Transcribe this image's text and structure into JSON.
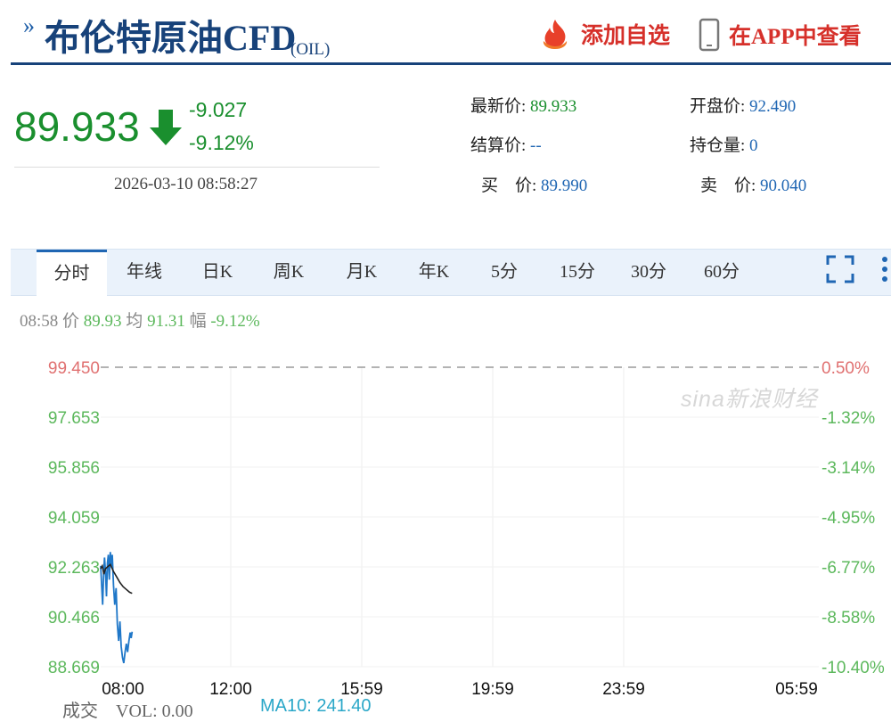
{
  "header": {
    "arrow_glyph": "»",
    "title": "布伦特原油CFD",
    "code": "(OIL)",
    "fav_label": "添加自选",
    "app_label": "在APP中查看",
    "fav_icon": "red-flame-icon",
    "app_icon": "mobile-phone-icon"
  },
  "quote": {
    "price": "89.933",
    "change": "-9.027",
    "change_pct": "-9.12%",
    "timestamp": "2026-03-10 08:58:27",
    "arrow_icon": "green-down-arrow-icon",
    "down_color": "#1a8f2e"
  },
  "details": {
    "latest_label": "最新价:",
    "latest_value": "89.933",
    "open_label": "开盘价:",
    "open_value": "92.490",
    "settle_label": "结算价:",
    "settle_value": "--",
    "oi_label": "持仓量:",
    "oi_value": "0",
    "bid_label": "买　价:",
    "bid_value": "89.990",
    "ask_label": "卖　价:",
    "ask_value": "90.040"
  },
  "tabs": [
    "分时",
    "年线",
    "日K",
    "周K",
    "月K",
    "年K",
    "5分",
    "15分",
    "30分",
    "60分"
  ],
  "active_tab": 0,
  "toolbar_icons": [
    "fullscreen-icon",
    "more-vertical-dots-icon"
  ],
  "info": {
    "time": "08:58",
    "price_label": "价",
    "price": "89.93",
    "avg_label": "均",
    "avg": "91.31",
    "amp_label": "幅",
    "amp": "-9.12%"
  },
  "watermark": "sina新浪财经",
  "volume": {
    "vol_text": "成交　VOL: 0.00",
    "ma_text": "MA10: 241.40"
  },
  "chart_data": {
    "type": "line",
    "title": "",
    "y_ticks": [
      "99.450",
      "97.653",
      "95.856",
      "94.059",
      "92.263",
      "90.466",
      "88.669"
    ],
    "y_tick_values": [
      99.45,
      97.653,
      95.856,
      94.059,
      92.263,
      90.466,
      88.669
    ],
    "y_right_ticks": [
      "0.50%",
      "-1.32%",
      "-3.14%",
      "-4.95%",
      "-6.77%",
      "-8.58%",
      "-10.40%"
    ],
    "ylim": [
      88.669,
      99.45
    ],
    "x_ticks": [
      "08:00",
      "12:00",
      "15:59",
      "19:59",
      "23:59",
      "05:59"
    ],
    "reference_line": 99.45,
    "colors": {
      "price": "#1f77c8",
      "average": "#222222",
      "up_axis": "#e07070",
      "down_axis": "#5cb85c",
      "reference": "#9a9a9a"
    },
    "series": [
      {
        "key": "price",
        "points": [
          [
            0,
            92.3
          ],
          [
            0.03,
            91.6
          ],
          [
            0.06,
            90.9
          ],
          [
            0.09,
            91.9
          ],
          [
            0.12,
            92.6
          ],
          [
            0.15,
            92.1
          ],
          [
            0.18,
            91.2
          ],
          [
            0.21,
            92.4
          ],
          [
            0.24,
            92.7
          ],
          [
            0.27,
            91.8
          ],
          [
            0.3,
            92.8
          ],
          [
            0.33,
            92.3
          ],
          [
            0.36,
            92.7
          ],
          [
            0.4,
            91.6
          ],
          [
            0.44,
            90.9
          ],
          [
            0.48,
            91.5
          ],
          [
            0.52,
            90.2
          ],
          [
            0.56,
            89.6
          ],
          [
            0.6,
            90.3
          ],
          [
            0.64,
            89.4
          ],
          [
            0.68,
            89.0
          ],
          [
            0.72,
            88.8
          ],
          [
            0.76,
            89.2
          ],
          [
            0.8,
            89.5
          ],
          [
            0.84,
            89.2
          ],
          [
            0.88,
            89.6
          ],
          [
            0.92,
            89.9
          ],
          [
            0.95,
            89.7
          ],
          [
            0.98,
            89.93
          ]
        ]
      },
      {
        "key": "average",
        "points": [
          [
            0,
            92.2
          ],
          [
            0.05,
            92.3
          ],
          [
            0.1,
            92.0
          ],
          [
            0.15,
            92.2
          ],
          [
            0.2,
            92.25
          ],
          [
            0.3,
            92.35
          ],
          [
            0.4,
            92.1
          ],
          [
            0.5,
            91.9
          ],
          [
            0.6,
            91.7
          ],
          [
            0.7,
            91.55
          ],
          [
            0.8,
            91.45
          ],
          [
            0.9,
            91.35
          ],
          [
            0.98,
            91.31
          ]
        ]
      }
    ]
  }
}
